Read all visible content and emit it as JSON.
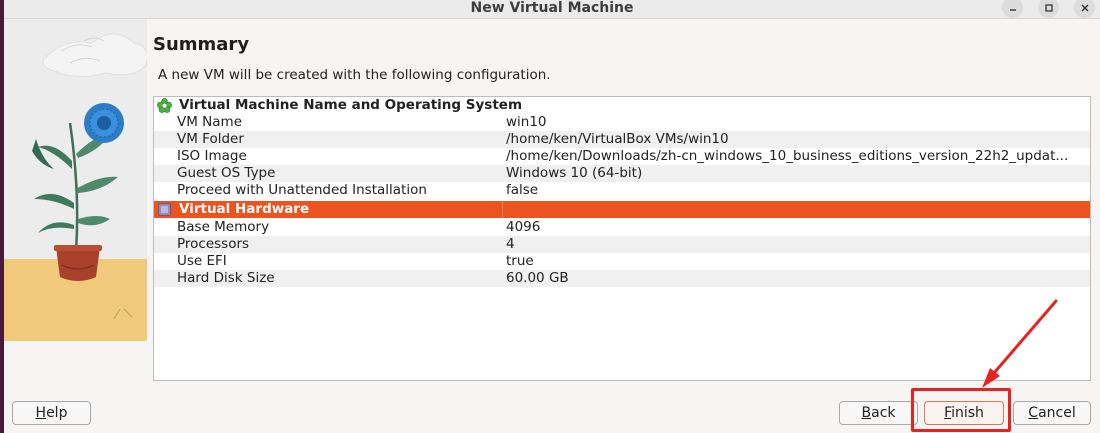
{
  "window": {
    "title": "New Virtual Machine"
  },
  "page": {
    "heading": "Summary",
    "description": "A new VM will be created with the following configuration."
  },
  "sections": [
    {
      "title": "Virtual Machine Name and Operating System",
      "icon": "green-gear-icon",
      "rows": [
        {
          "key": "VM Name",
          "value": "win10"
        },
        {
          "key": "VM Folder",
          "value": "/home/ken/VirtualBox VMs/win10"
        },
        {
          "key": "ISO Image",
          "value": "/home/ken/Downloads/zh-cn_windows_10_business_editions_version_22h2_updat..."
        },
        {
          "key": "Guest OS Type",
          "value": "Windows 10 (64-bit)"
        },
        {
          "key": "Proceed with Unattended Installation",
          "value": "false"
        }
      ]
    },
    {
      "title": "Virtual Hardware",
      "icon": "chip-icon",
      "rows": [
        {
          "key": "Base Memory",
          "value": "4096"
        },
        {
          "key": "Processors",
          "value": "4"
        },
        {
          "key": "Use EFI",
          "value": "true"
        },
        {
          "key": "Hard Disk Size",
          "value": "60.00 GB"
        }
      ]
    }
  ],
  "buttons": {
    "help": {
      "pre": "",
      "mnemonic": "H",
      "post": "elp"
    },
    "back": {
      "pre": "",
      "mnemonic": "B",
      "post": "ack"
    },
    "finish": {
      "pre": "",
      "mnemonic": "F",
      "post": "inish"
    },
    "cancel": {
      "pre": "",
      "mnemonic": "C",
      "post": "ancel"
    }
  },
  "colors": {
    "selection": "#e95420",
    "annotation": "#e8231f"
  }
}
